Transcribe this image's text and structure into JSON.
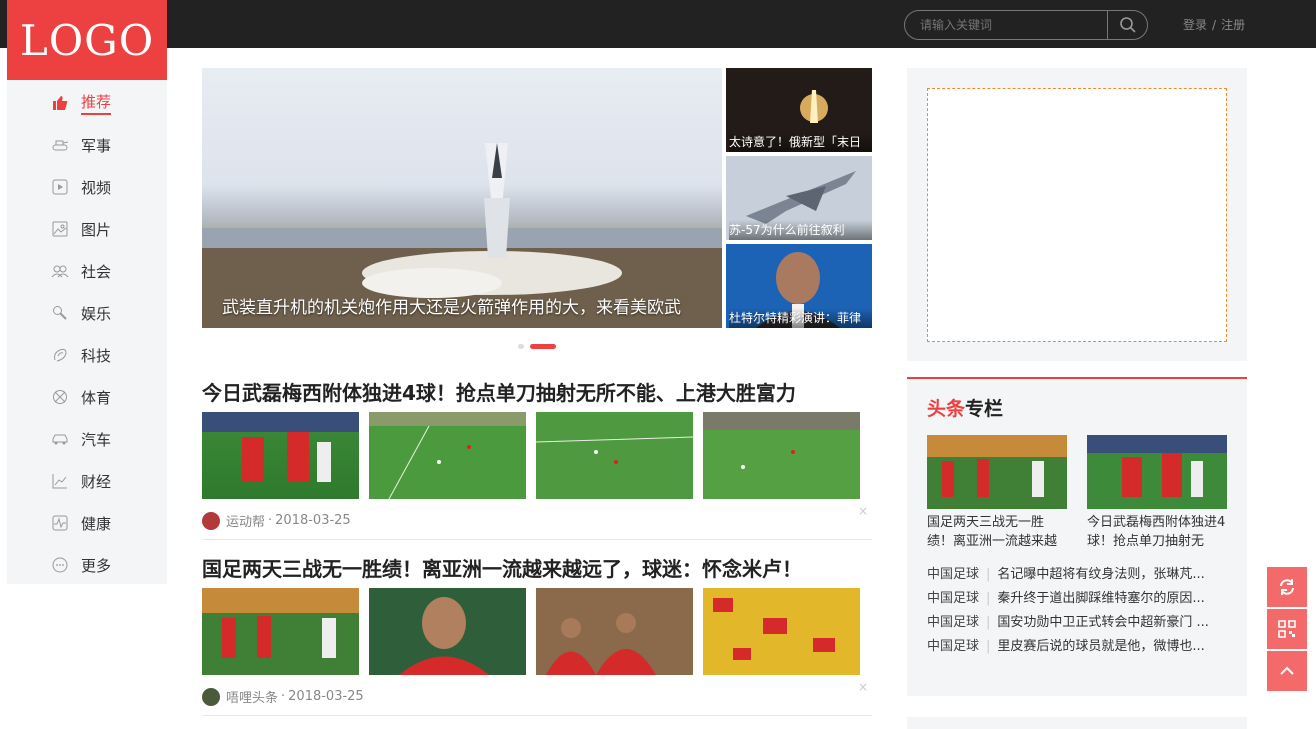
{
  "header": {
    "logo_text": "LOGO",
    "search_placeholder": "请输入关键词",
    "login": "登录",
    "separator": "/",
    "register": "注册"
  },
  "sidebar": {
    "items": [
      {
        "label": "推荐",
        "icon": "thumbs-up-icon"
      },
      {
        "label": "军事",
        "icon": "tank-icon"
      },
      {
        "label": "视频",
        "icon": "video-icon"
      },
      {
        "label": "图片",
        "icon": "image-icon"
      },
      {
        "label": "社会",
        "icon": "people-icon"
      },
      {
        "label": "娱乐",
        "icon": "microphone-icon"
      },
      {
        "label": "科技",
        "icon": "tech-icon"
      },
      {
        "label": "体育",
        "icon": "basketball-icon"
      },
      {
        "label": "汽车",
        "icon": "car-icon"
      },
      {
        "label": "财经",
        "icon": "chart-icon"
      },
      {
        "label": "健康",
        "icon": "heartbeat-icon"
      },
      {
        "label": "更多",
        "icon": "more-icon"
      }
    ]
  },
  "slider": {
    "main_caption": "武装直升机的机关炮作用大还是火箭弹作用的大，来看美欧武",
    "side": [
      {
        "caption": "太诗意了！俄新型「末日"
      },
      {
        "caption": "苏-57为什么前往叙利"
      },
      {
        "caption": "杜特尔特精彩演讲：菲律"
      }
    ]
  },
  "articles": [
    {
      "title": "今日武磊梅西附体独进4球！抢点单刀抽射无所不能、上港大胜富力",
      "source": "运动帮",
      "date": "2018-03-25"
    },
    {
      "title": "国足两天三战无一胜绩！离亚洲一流越来越远了，球迷：怀念米卢！",
      "source": "唔哩头条",
      "date": "2018-03-25"
    }
  ],
  "dot_sep": "·",
  "close_glyph": "×",
  "column": {
    "title_red": "头条",
    "title_black": "专栏",
    "cards": [
      {
        "text": "国足两天三战无一胜绩！离亚洲一流越来越"
      },
      {
        "text": "今日武磊梅西附体独进4球！抢点单刀抽射无"
      }
    ],
    "links": [
      {
        "tag": "中国足球",
        "text": "名记曝中超将有纹身法则，张琳芃..."
      },
      {
        "tag": "中国足球",
        "text": "秦升终于道出脚踩维特塞尔的原因..."
      },
      {
        "tag": "中国足球",
        "text": "国安功勋中卫正式转会中超新豪门 ..."
      },
      {
        "tag": "中国足球",
        "text": "里皮赛后说的球员就是他，微博也..."
      }
    ]
  },
  "colors": {
    "accent": "#ed4040",
    "topbar": "#222222",
    "panel": "#f4f5f6",
    "float": "#f46a6a"
  }
}
